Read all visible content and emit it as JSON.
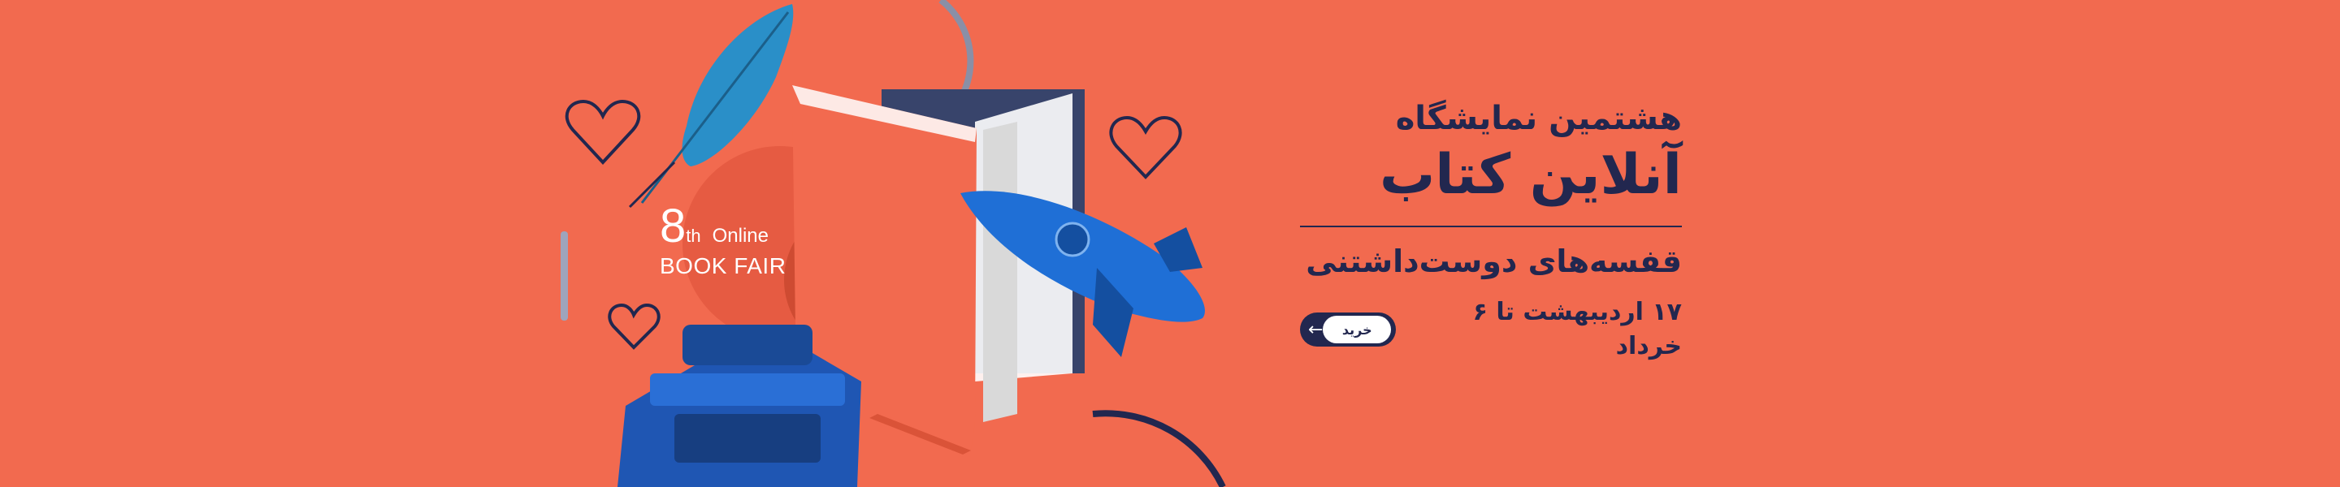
{
  "banner": {
    "badge": {
      "number": "8",
      "suffix": "th",
      "online": "Online",
      "subtitle": "BOOK FAIR"
    },
    "title_line1": "هشتمین نمایشگاه",
    "title_line2": "آنلاین کتاب",
    "subtitle": "قفسه‌های دوست‌داشتنی",
    "date": "۱۷ اردیبهشت تا ۶ خرداد",
    "buy_label": "خرید",
    "buy_arrow": "←"
  },
  "colors": {
    "background": "#f26a4f",
    "navy": "#22274f",
    "blue": "#1f6fd6",
    "teal": "#2a8fc8",
    "white": "#ffffff"
  },
  "decorations": {
    "icons": [
      "feather-icon",
      "heart-icon",
      "heart-icon",
      "heart-icon",
      "rocket-icon",
      "typewriter-icon",
      "open-book-icon"
    ]
  }
}
